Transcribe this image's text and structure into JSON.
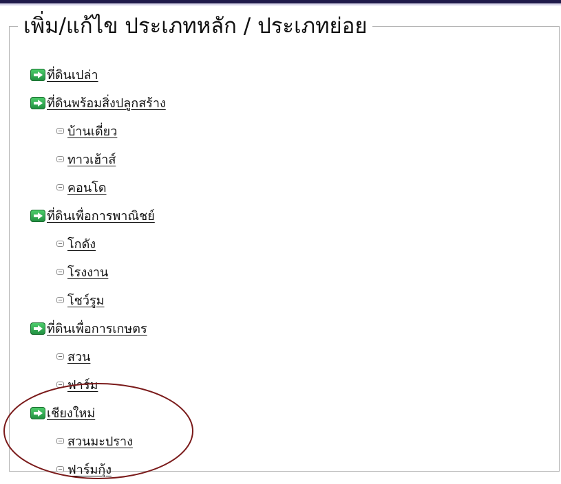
{
  "panel": {
    "title": "เพิ่ม/แก้ไข ประเภทหลัก / ประเภทย่อย"
  },
  "tree": [
    {
      "label": "ที่ดินเปล่า",
      "icon": "green-arrow-icon",
      "children": []
    },
    {
      "label": "ที่ดินพร้อมสิ่งปลูกสร้าง",
      "icon": "green-arrow-icon",
      "children": [
        {
          "label": "บ้านเดี่ยว",
          "icon": "minus-box-icon"
        },
        {
          "label": "ทาวเฮ้าส์",
          "icon": "minus-box-icon"
        },
        {
          "label": "คอนโด",
          "icon": "minus-box-icon"
        }
      ]
    },
    {
      "label": "ที่ดินเพื่อการพาณิชย์",
      "icon": "green-arrow-icon",
      "children": [
        {
          "label": "โกดัง",
          "icon": "minus-box-icon"
        },
        {
          "label": "โรงงาน",
          "icon": "minus-box-icon"
        },
        {
          "label": "โชว์รูม",
          "icon": "minus-box-icon"
        }
      ]
    },
    {
      "label": "ที่ดินเพื่อการเกษตร",
      "icon": "green-arrow-icon",
      "children": [
        {
          "label": "สวน",
          "icon": "minus-box-icon"
        },
        {
          "label": "ฟาร์ม",
          "icon": "minus-box-icon"
        }
      ]
    },
    {
      "label": "เชียงใหม่",
      "icon": "green-arrow-icon",
      "children": [
        {
          "label": "สวนมะปราง",
          "icon": "minus-box-icon"
        },
        {
          "label": "ฟาร์มกุ้ง",
          "icon": "minus-box-icon"
        }
      ]
    }
  ],
  "colors": {
    "accent_green": "#2aa84b",
    "annotation_red": "#7a1a1a"
  }
}
